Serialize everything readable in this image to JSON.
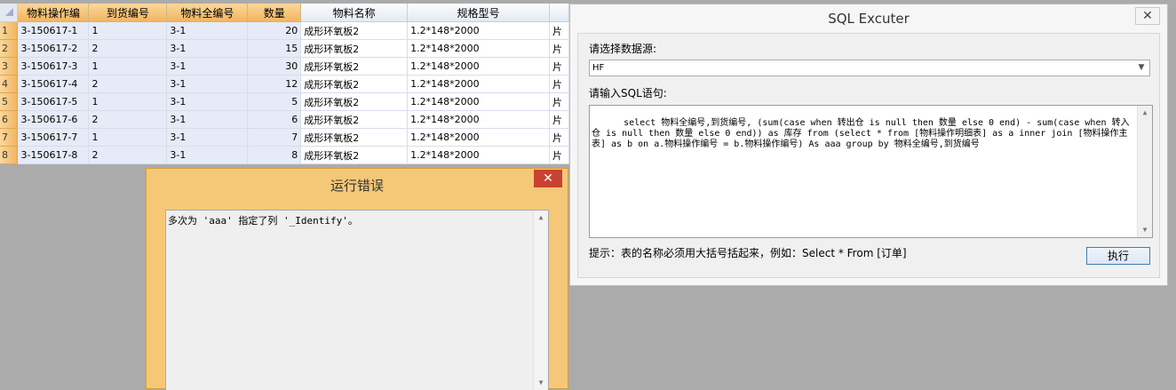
{
  "grid": {
    "columns": [
      "物料操作编",
      "到货编号",
      "物料全编号",
      "数量",
      "物料名称",
      "规格型号",
      ""
    ],
    "rows": [
      {
        "num": "1",
        "op": "3-150617-1",
        "arrival": "1",
        "full": "3-1",
        "qty": "20",
        "name": "成形环氧板2",
        "spec": "1.2*148*2000",
        "unit": "片"
      },
      {
        "num": "2",
        "op": "3-150617-2",
        "arrival": "2",
        "full": "3-1",
        "qty": "15",
        "name": "成形环氧板2",
        "spec": "1.2*148*2000",
        "unit": "片"
      },
      {
        "num": "3",
        "op": "3-150617-3",
        "arrival": "1",
        "full": "3-1",
        "qty": "30",
        "name": "成形环氧板2",
        "spec": "1.2*148*2000",
        "unit": "片"
      },
      {
        "num": "4",
        "op": "3-150617-4",
        "arrival": "2",
        "full": "3-1",
        "qty": "12",
        "name": "成形环氧板2",
        "spec": "1.2*148*2000",
        "unit": "片"
      },
      {
        "num": "5",
        "op": "3-150617-5",
        "arrival": "1",
        "full": "3-1",
        "qty": "5",
        "name": "成形环氧板2",
        "spec": "1.2*148*2000",
        "unit": "片"
      },
      {
        "num": "6",
        "op": "3-150617-6",
        "arrival": "2",
        "full": "3-1",
        "qty": "6",
        "name": "成形环氧板2",
        "spec": "1.2*148*2000",
        "unit": "片"
      },
      {
        "num": "7",
        "op": "3-150617-7",
        "arrival": "1",
        "full": "3-1",
        "qty": "7",
        "name": "成形环氧板2",
        "spec": "1.2*148*2000",
        "unit": "片"
      },
      {
        "num": "8",
        "op": "3-150617-8",
        "arrival": "2",
        "full": "3-1",
        "qty": "8",
        "name": "成形环氧板2",
        "spec": "1.2*148*2000",
        "unit": "片"
      }
    ]
  },
  "sql_window": {
    "title": "SQL Excuter",
    "close_glyph": "✕",
    "datasource_label": "请选择数据源:",
    "datasource_value": "HF",
    "sql_label": "请输入SQL语句:",
    "sql_text": "select 物料全编号,到货编号, (sum(case when 转出仓 is null then 数量 else 0 end) - sum(case when 转入仓 is null then 数量 else 0 end)) as 库存 from (select * from [物料操作明细表] as a inner join [物料操作主表] as b on a.物料操作编号 = b.物料操作编号) As aaa group by 物料全编号,到货编号",
    "hint": "提示：表的名称必须用大括号括起来，例如：Select * From [订单]",
    "run_label": "执行"
  },
  "error_dialog": {
    "title": "运行错误",
    "close_glyph": "✕",
    "message": "多次为 'aaa' 指定了列 '_Identify'。"
  },
  "colors": {
    "selected_header": "#f2b560",
    "selected_cells": "#e6ebf7",
    "desktop": "#ababab",
    "error_frame": "#f5c877",
    "close_red": "#c84232"
  }
}
